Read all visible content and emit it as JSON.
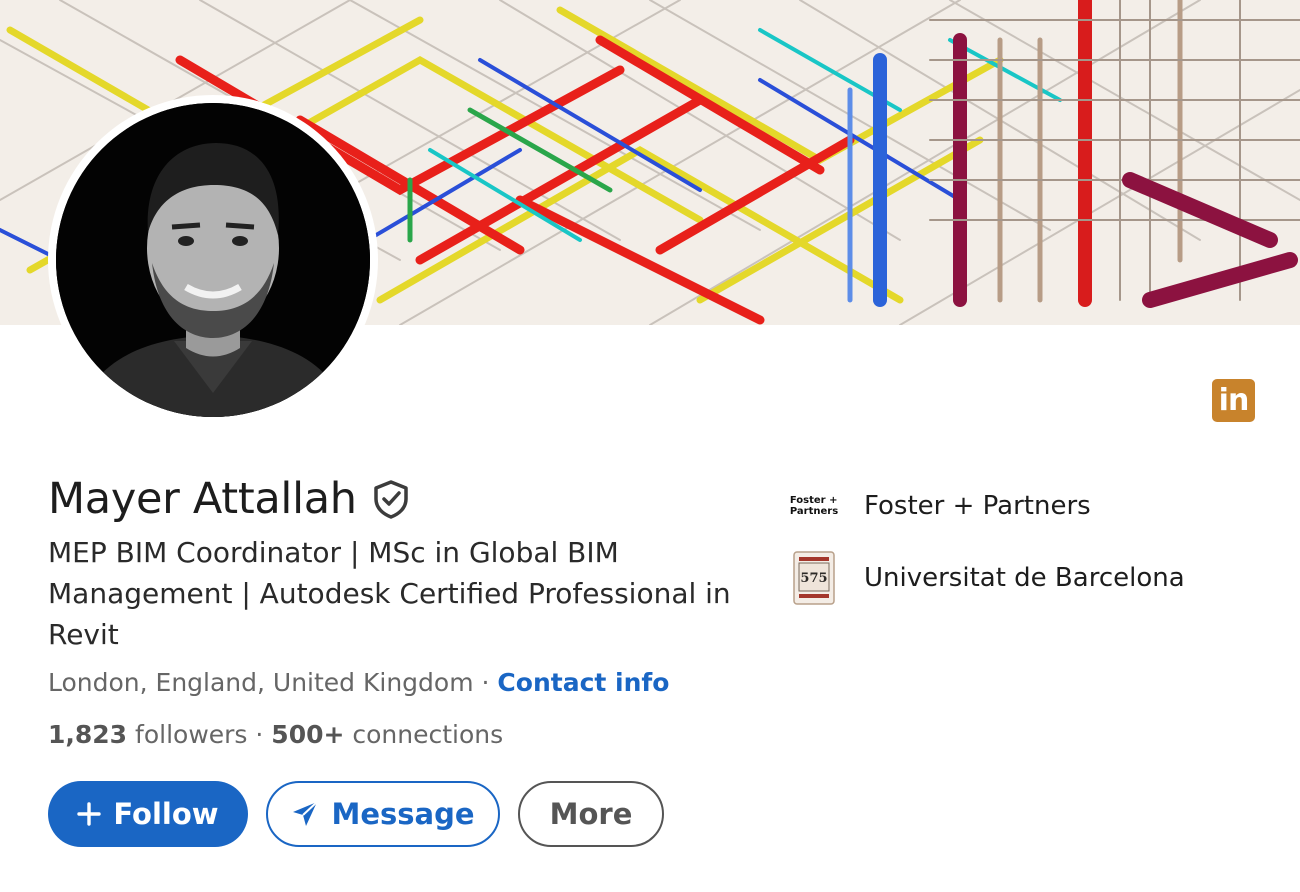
{
  "profile": {
    "name": "Mayer Attallah",
    "headline": "MEP BIM Coordinator | MSc in Global BIM Management | Autodesk Certified Professional in Revit",
    "location": "London, England, United Kingdom",
    "location_separator": " · ",
    "contact_label": "Contact info",
    "followers_count": "1,823",
    "followers_label": "followers",
    "stats_separator": "  · ",
    "connections_count": "500+",
    "connections_label": "connections"
  },
  "actions": {
    "follow_label": "Follow",
    "message_label": "Message",
    "more_label": "More"
  },
  "organizations": [
    {
      "name": "Foster + Partners",
      "logo_text_line1": "Foster +",
      "logo_text_line2": "Partners"
    },
    {
      "name": "Universitat de Barcelona",
      "logo_text": "575"
    }
  ],
  "icons": {
    "linkedin": "linkedin-icon",
    "verified": "verified-shield-icon",
    "plus": "plus-icon",
    "send": "send-icon"
  },
  "colors": {
    "primary": "#1a66c4",
    "linkedin_badge": "#c8832c",
    "muted_text": "#666666"
  }
}
